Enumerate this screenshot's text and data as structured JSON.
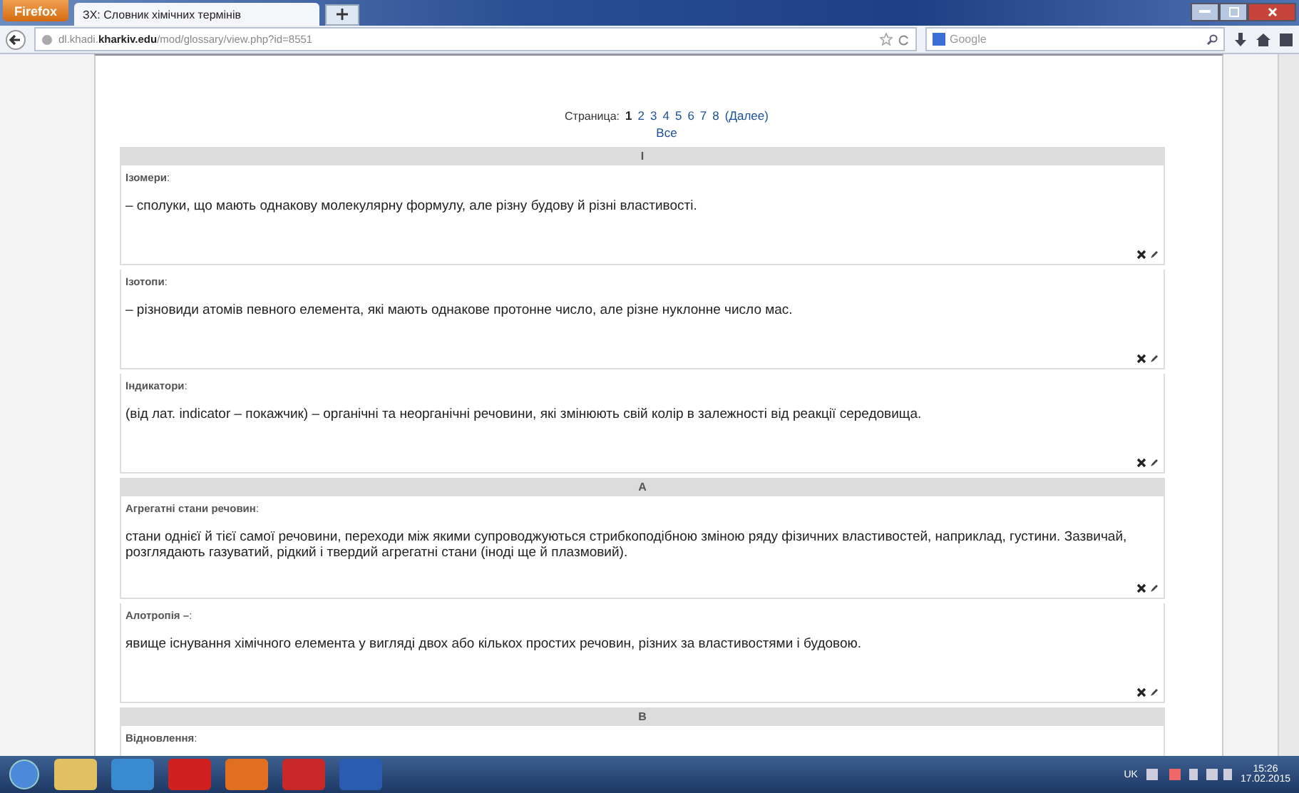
{
  "browser": {
    "menu_button": "Firefox",
    "tab_title": "ЗХ: Словник хімічних термінів",
    "url_prefix": "dl.khadi.",
    "url_domain": "kharkiv.edu",
    "url_path": "/mod/glossary/view.php?id=8551",
    "search_placeholder": "Google"
  },
  "pagination": {
    "label": "Страница:",
    "pages": [
      {
        "label": "1",
        "selected": true
      },
      {
        "label": "2",
        "selected": false
      },
      {
        "label": "3",
        "selected": false
      },
      {
        "label": "4",
        "selected": false
      },
      {
        "label": "5",
        "selected": false
      },
      {
        "label": "6",
        "selected": false
      },
      {
        "label": "7",
        "selected": false
      },
      {
        "label": "8",
        "selected": false
      }
    ],
    "next": "(Далее)",
    "all": "Все"
  },
  "sections": [
    {
      "letter": "І",
      "entries": [
        {
          "term": "**Ізомери**:",
          "definition": "– сполуки, що мають однакову молекулярну формулу, але різну будову й різні властивості."
        },
        {
          "term": "**Ізотопи**:",
          "definition": "– різновиди атомів певного елемента, які мають однакове протонне число, але різне нуклонне число мас."
        },
        {
          "term": "**Індикатори**:",
          "definition": "(від лат. indicator – покажчик) – органічні та неорганічні речовини, які змінюють свій колір в залежності від реакції середовища."
        }
      ]
    },
    {
      "letter": "А",
      "entries": [
        {
          "term": "**Агрегатні стани речовин**:",
          "definition": "стани однієї й тієї самої речовини, переходи між якими супроводжуються стрибкоподібною зміною ряду фізичних властивостей, наприклад, густини. Зазвичай, розглядають газуватий, рідкий і твердий агрегатні стани (іноді ще й плазмовий)."
        },
        {
          "term": "**Алотропія –**:",
          "definition": "явище існування хімічного елемента у вигляді двох або кількох простих речовин, різних за властивостями і будовою."
        }
      ]
    },
    {
      "letter": "В",
      "entries": [
        {
          "term": "**Відновлення**:"
        }
      ]
    }
  ],
  "taskbar": {
    "language": "UK",
    "time": "15:26",
    "date": "17.02.2015"
  }
}
